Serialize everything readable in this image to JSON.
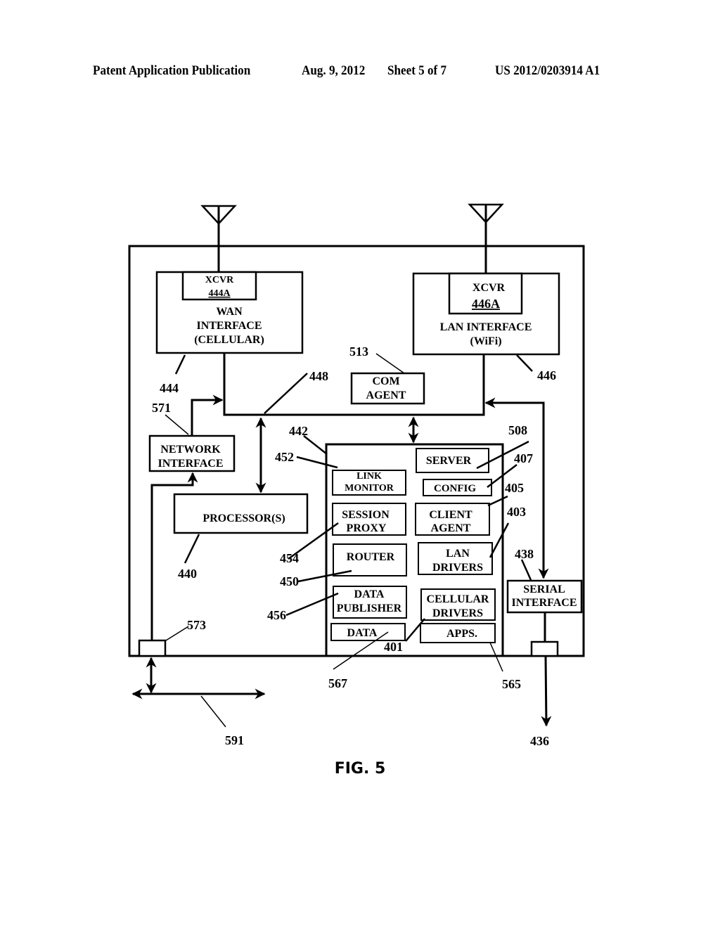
{
  "header": {
    "publication": "Patent Application Publication",
    "date": "Aug. 9, 2012",
    "sheet": "Sheet 5 of 7",
    "number": "US 2012/0203914 A1"
  },
  "figure_label": "FIG. 5",
  "boxes": {
    "wan_xcvr": [
      "XCVR",
      "444A"
    ],
    "wan_interface": [
      "WAN",
      "INTERFACE",
      "(CELLULAR)"
    ],
    "lan_xcvr": [
      "XCVR",
      "446A"
    ],
    "lan_interface": [
      "LAN INTERFACE",
      "(WiFi)"
    ],
    "com_agent": [
      "COM",
      "AGENT"
    ],
    "network_interface": [
      "NETWORK",
      "INTERFACE"
    ],
    "processor": [
      "PROCESSOR(S)"
    ],
    "server": [
      "SERVER"
    ],
    "link_monitor": [
      "LINK",
      "MONITOR"
    ],
    "config": [
      "CONFIG"
    ],
    "session_proxy": [
      "SESSION",
      "PROXY"
    ],
    "client_agent": [
      "CLIENT",
      "AGENT"
    ],
    "router": [
      "ROUTER"
    ],
    "lan_drivers": [
      "LAN",
      "DRIVERS"
    ],
    "data_publisher": [
      "DATA",
      "PUBLISHER"
    ],
    "cellular_drivers": [
      "CELLULAR",
      "DRIVERS"
    ],
    "data": [
      "DATA"
    ],
    "apps": [
      "APPS."
    ],
    "serial_interface": [
      "SERIAL",
      "INTERFACE"
    ]
  },
  "refs": {
    "r444": "444",
    "r446": "446",
    "r448": "448",
    "r513": "513",
    "r571": "571",
    "r442": "442",
    "r452": "452",
    "r508": "508",
    "r407": "407",
    "r405": "405",
    "r403": "403",
    "r438": "438",
    "r440": "440",
    "r454": "454",
    "r450": "450",
    "r456": "456",
    "r573": "573",
    "r401": "401",
    "r567": "567",
    "r565": "565",
    "r591": "591",
    "r436": "436"
  }
}
